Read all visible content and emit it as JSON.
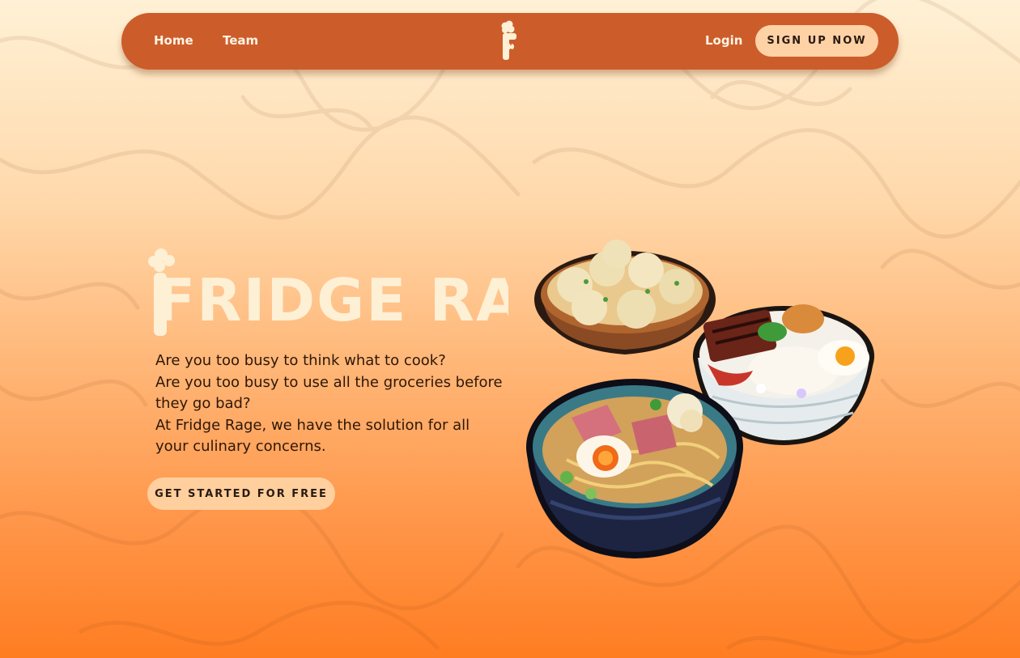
{
  "nav": {
    "home_label": "Home",
    "team_label": "Team",
    "login_label": "Login",
    "signup_label": "SIGN UP NOW"
  },
  "hero": {
    "brand_name": "FRIDGE RAGE",
    "lines": [
      "Are you too busy to think what to cook?",
      "Are you too busy to use all the groceries before they go bad?",
      "At Fridge Rage, we have the solution for all your culinary concerns."
    ],
    "cta_label": "GET STARTED FOR FREE"
  },
  "colors": {
    "nav_bg": "#cc5d2b",
    "button_bg": "#ffd2a6",
    "brand_text": "#fdf0d5",
    "gradient_top": "#fff1d6",
    "gradient_bottom": "#ff7d22"
  }
}
